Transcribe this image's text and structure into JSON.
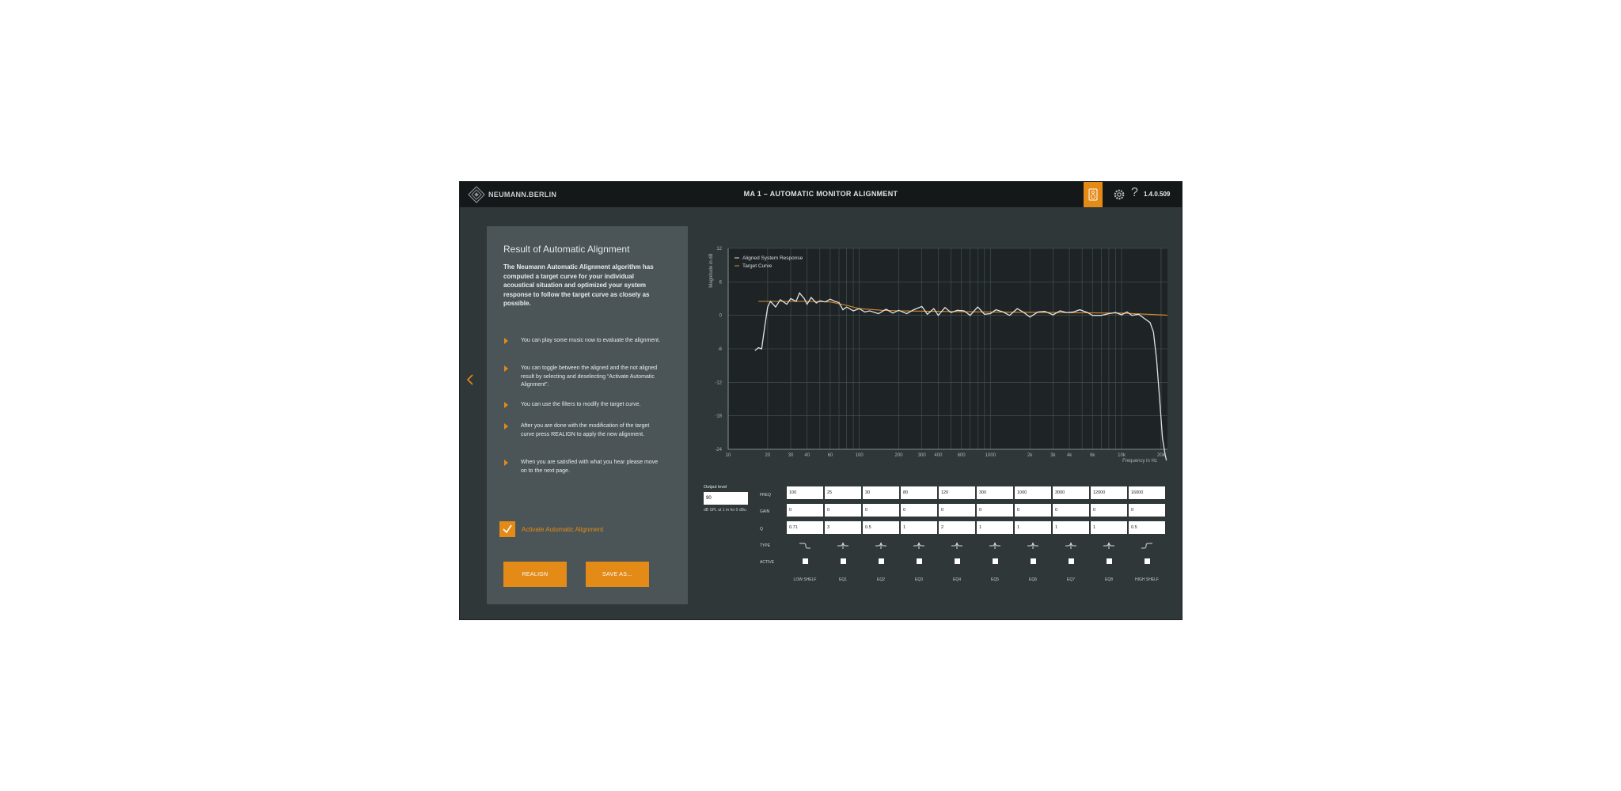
{
  "header": {
    "brand": "NEUMANN.BERLIN",
    "title": "MA 1 – AUTOMATIC MONITOR ALIGNMENT",
    "version": "1.4.0.509",
    "icons": [
      "logo-diamond",
      "speaker-icon",
      "gear-icon",
      "help-icon"
    ]
  },
  "panel": {
    "title": "Result of Automatic Alignment",
    "intro": "The Neumann Automatic Alignment algorithm has computed a target curve for your individual acoustical situation and optimized your system response to follow the target curve as closely as possible.",
    "bullets": [
      "You can play some music now to evaluate the alignment.",
      "You can toggle between the aligned and the not aligned result by selecting and deselecting “Activate Automatic Alignment”.",
      "You can use the filters to modify the target curve.",
      "After you are done with the modification of the target curve press REALIGN to apply the new alignment.",
      "When you are satisfied with what you hear please move on to the next page."
    ],
    "activate_label": "Activate Automatic Alignment",
    "activate_checked": true,
    "realign_label": "REALIGN",
    "save_label": "SAVE AS..."
  },
  "output": {
    "label": "Output level",
    "value": "90",
    "unit": "dB SPL at 1 m for 0 dBu"
  },
  "eq": {
    "row_labels": {
      "freq": "FREQ",
      "gain": "GAIN",
      "q": "Q",
      "type": "TYPE",
      "active": "ACTIVE"
    },
    "bands": [
      {
        "name": "LOW SHELF",
        "freq": "100",
        "gain": "0",
        "q": "0.71",
        "type": "low-shelf-icon"
      },
      {
        "name": "EQ1",
        "freq": "25",
        "gain": "0",
        "q": "3",
        "type": "peak-icon"
      },
      {
        "name": "EQ2",
        "freq": "30",
        "gain": "0",
        "q": "0.5",
        "type": "peak-icon"
      },
      {
        "name": "EQ3",
        "freq": "80",
        "gain": "0",
        "q": "1",
        "type": "peak-icon"
      },
      {
        "name": "EQ4",
        "freq": "120",
        "gain": "0",
        "q": "2",
        "type": "peak-icon"
      },
      {
        "name": "EQ5",
        "freq": "300",
        "gain": "0",
        "q": "1",
        "type": "peak-icon"
      },
      {
        "name": "EQ6",
        "freq": "1000",
        "gain": "0",
        "q": "1",
        "type": "peak-icon"
      },
      {
        "name": "EQ7",
        "freq": "3000",
        "gain": "0",
        "q": "1",
        "type": "peak-icon"
      },
      {
        "name": "EQ8",
        "freq": "12000",
        "gain": "0",
        "q": "1",
        "type": "peak-icon"
      },
      {
        "name": "HIGH SHELF",
        "freq": "16000",
        "gain": "0",
        "q": "0.5",
        "type": "high-shelf-icon"
      }
    ]
  },
  "colors": {
    "accent": "#e38a17",
    "background": "#2f3739",
    "panel": "#4b5557",
    "topbar": "#141819",
    "plot": "#1e2426"
  },
  "chart_data": {
    "type": "line",
    "xlabel": "Frequency in Hz",
    "ylabel": "Magnitude in dB",
    "xscale": "log",
    "xlim": [
      10,
      24000
    ],
    "ylim": [
      -24,
      12
    ],
    "yticks": [
      12,
      6,
      0,
      -6,
      -12,
      -18,
      -24
    ],
    "xticks": [
      {
        "value": 10,
        "label": "10"
      },
      {
        "value": 20,
        "label": "20"
      },
      {
        "value": 30,
        "label": "30"
      },
      {
        "value": 40,
        "label": "40"
      },
      {
        "value": 60,
        "label": "60"
      },
      {
        "value": 100,
        "label": "100"
      },
      {
        "value": 200,
        "label": "200"
      },
      {
        "value": 300,
        "label": "300"
      },
      {
        "value": 400,
        "label": "400"
      },
      {
        "value": 600,
        "label": "600"
      },
      {
        "value": 1000,
        "label": "1000"
      },
      {
        "value": 2000,
        "label": "2k"
      },
      {
        "value": 3000,
        "label": "3k"
      },
      {
        "value": 4000,
        "label": "4k"
      },
      {
        "value": 6000,
        "label": "6k"
      },
      {
        "value": 10000,
        "label": "10k"
      },
      {
        "value": 20000,
        "label": "20k"
      }
    ],
    "legend": "top-left",
    "grid": true,
    "series": [
      {
        "name": "Aligned System Response",
        "color": "#e2e2e2",
        "x": [
          16,
          17,
          18,
          19,
          20,
          21,
          23,
          25,
          28,
          30,
          33,
          35,
          38,
          40,
          43,
          47,
          50,
          55,
          60,
          65,
          70,
          75,
          80,
          90,
          100,
          110,
          120,
          140,
          160,
          180,
          200,
          230,
          260,
          300,
          330,
          370,
          400,
          450,
          500,
          560,
          630,
          700,
          800,
          900,
          1000,
          1100,
          1250,
          1400,
          1600,
          1800,
          2000,
          2300,
          2600,
          3000,
          3400,
          3800,
          4300,
          4800,
          5500,
          6000,
          7000,
          8000,
          9000,
          10000,
          11000,
          12000,
          13500,
          15000,
          16500,
          17500,
          18500,
          19500,
          20500,
          21500,
          22000
        ],
        "y": [
          -6.3,
          -5.8,
          -6,
          -2,
          1.5,
          2.5,
          1.5,
          2.8,
          2,
          3,
          2.5,
          4,
          3,
          2,
          3.2,
          2.2,
          2.6,
          2.4,
          2.9,
          2.5,
          2.3,
          1,
          1.5,
          0.8,
          1.2,
          0.6,
          0.8,
          0.3,
          1.1,
          0.4,
          0.9,
          0.3,
          1,
          1.6,
          0.2,
          1.2,
          0,
          1.4,
          0.5,
          0.9,
          0.8,
          0,
          1.5,
          0.2,
          0.3,
          1,
          0.6,
          0,
          1.2,
          0.5,
          -0.3,
          0.6,
          0.7,
          0.1,
          0.8,
          0.5,
          0.6,
          1,
          0.5,
          0,
          0,
          0.3,
          0.5,
          0.1,
          0.6,
          0,
          0.2,
          -0.6,
          -1.3,
          -3,
          -8,
          -15,
          -22,
          -25,
          -26
        ]
      },
      {
        "name": "Target Curve",
        "color": "#d98a2b",
        "x": [
          17,
          25,
          40,
          60,
          80,
          100,
          150,
          200,
          400,
          1000,
          3000,
          10000,
          24000
        ],
        "y": [
          2.5,
          2.5,
          2.5,
          2.4,
          1.8,
          1.2,
          0.9,
          0.8,
          0.7,
          0.6,
          0.5,
          0.4,
          0
        ]
      }
    ]
  }
}
